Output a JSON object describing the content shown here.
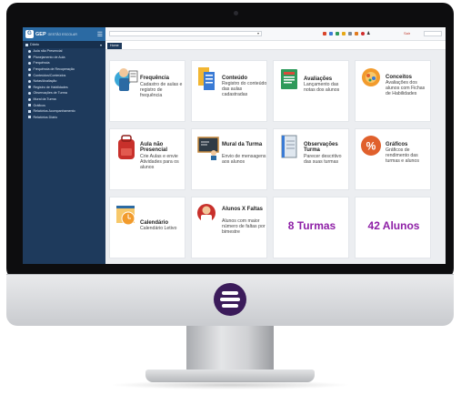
{
  "brand": {
    "name": "GEP",
    "subtitle": "GESTÃO ESCOLAR"
  },
  "sidebar": {
    "section": "Diário",
    "items": [
      {
        "label": "Aula não Presencial",
        "icon": "dot-icon"
      },
      {
        "label": "Planejamento de Aula",
        "icon": "dot-icon"
      },
      {
        "label": "Frequência",
        "icon": "dot-icon"
      },
      {
        "label": "Frequência de Recuperação",
        "icon": "dot-icon"
      },
      {
        "label": "Conteúdos/Conteúdos",
        "icon": "dot-icon"
      },
      {
        "label": "Notas/Avaliação",
        "icon": "dot-icon"
      },
      {
        "label": "Registro de Habilidades",
        "icon": "dot-icon"
      },
      {
        "label": "Observações de Turma",
        "icon": "dot-icon"
      },
      {
        "label": "Mural da Turma",
        "icon": "dot-icon"
      },
      {
        "label": "Gráficos",
        "icon": "chart-icon"
      },
      {
        "label": "Relatórios Acompanhamento",
        "icon": "print-icon"
      },
      {
        "label": "Relatórios Diário",
        "icon": "print-icon"
      }
    ]
  },
  "topbar": {
    "search_value": "",
    "year_label": "Sair"
  },
  "tabs": [
    {
      "label": "Home"
    }
  ],
  "cards": [
    {
      "title": "Frequência",
      "desc": "Cadastro de aulas e registro de frequência",
      "icon": "teacher-icon"
    },
    {
      "title": "Conteúdo",
      "desc": "Registro do conteúdo das aulas cadastradas",
      "icon": "documents-icon"
    },
    {
      "title": "Avaliações",
      "desc": "Lançamento das notas dos alunos",
      "icon": "book-icon"
    },
    {
      "title": "Conceitos",
      "desc": "Avaliações dos alunos com Fichas de Habilidades",
      "icon": "brain-icon"
    },
    {
      "title": "Aula não Presencial",
      "desc": "Crie Aulas e envie Atividades para os alunos",
      "icon": "backpack-icon"
    },
    {
      "title": "Mural da Turma",
      "desc": "Envio de mensagens aos alunos",
      "icon": "blackboard-icon"
    },
    {
      "title": "Observações Turma",
      "desc": "Parecer descritivo das suas turmas",
      "icon": "notebook-icon"
    },
    {
      "title": "Gráficos",
      "desc": "Gráficos de rendimento das turmas e alunos",
      "icon": "percent-icon"
    },
    {
      "title": "Calendário",
      "desc": "Calendário Letivo",
      "icon": "calendar-icon"
    },
    {
      "title": "Alunos X Faltas",
      "desc": "Alunos com maior número de faltas por bimestre",
      "icon": "student-icon"
    }
  ],
  "stats": {
    "turmas": "8 Turmas",
    "alunos": "42 Alunos"
  },
  "colors": {
    "sidebar": "#1e3a5c",
    "brand": "#2b6aa3",
    "accent": "#8e1fa6"
  }
}
